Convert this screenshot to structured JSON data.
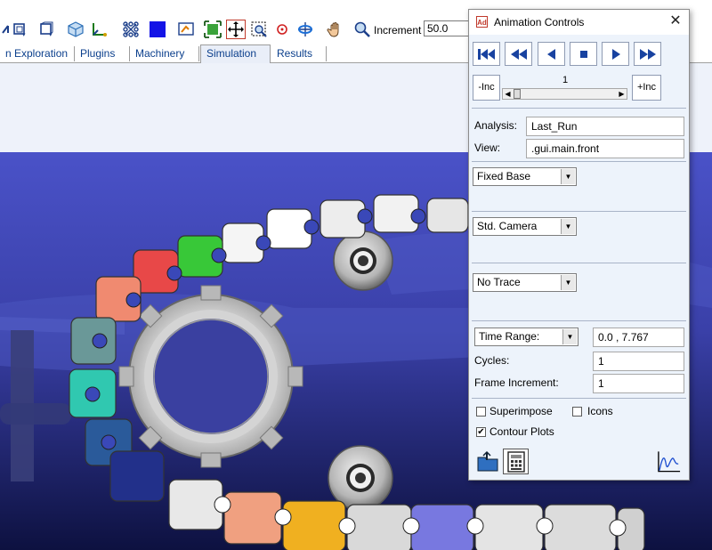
{
  "toolbar": {
    "increment_label": "Increment",
    "increment_value": "50.0",
    "icons": [
      "iso-view-icon",
      "front-view-icon",
      "side-view-icon",
      "cube-view-icon",
      "axes-icon",
      "mesh-icon",
      "solid-color-icon",
      "render-icon",
      "fit-all-icon",
      "fit-selection-icon",
      "zoom-box-icon",
      "target-icon",
      "rotate-icon",
      "pan-hand-icon",
      "zoom-icon"
    ]
  },
  "tabs": [
    {
      "label": "n Exploration",
      "active": false
    },
    {
      "label": "Plugins",
      "active": false
    },
    {
      "label": "Machinery",
      "active": false
    },
    {
      "label": "Simulation",
      "active": true
    },
    {
      "label": "Results",
      "active": false
    }
  ],
  "anim": {
    "logo": "Ad",
    "title": "Animation Controls",
    "close": "✕",
    "dec_inc_label": "-Inc",
    "inc_label": "+Inc",
    "frame_value": "1",
    "analysis_label": "Analysis:",
    "analysis_value": "Last_Run",
    "view_label": "View:",
    "view_value": ".gui.main.front",
    "base_value": "Fixed Base",
    "camera_value": "Std. Camera",
    "trace_value": "No Trace",
    "time_mode_value": "Time Range:",
    "time_range_value": "0.0 , 7.767",
    "cycles_label": "Cycles:",
    "cycles_value": "1",
    "frame_inc_label": "Frame Increment:",
    "frame_inc_value": "1",
    "superimpose_label": "Superimpose",
    "superimpose_checked": false,
    "icons_label": "Icons",
    "icons_checked": false,
    "contour_label": "Contour Plots",
    "contour_checked": true,
    "check_mark": "✔"
  }
}
